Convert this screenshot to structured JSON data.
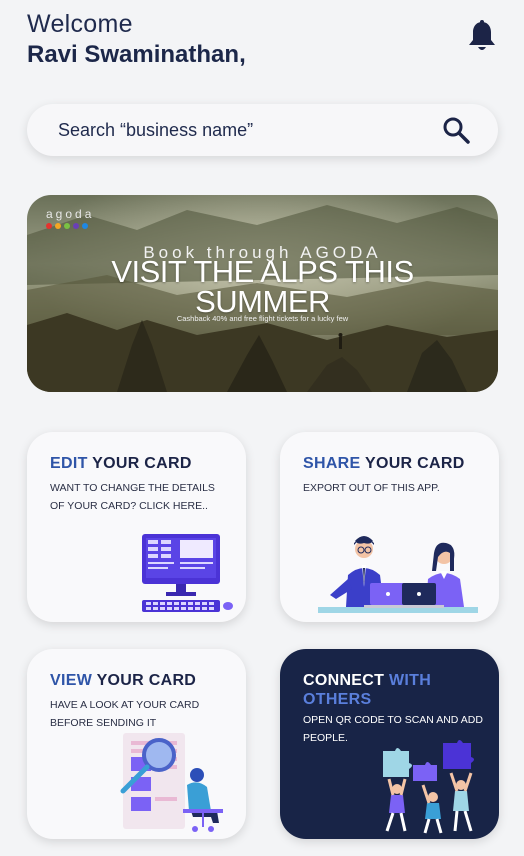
{
  "header": {
    "welcome": "Welcome",
    "user_name": "Ravi Swaminathan,"
  },
  "search": {
    "placeholder": "Search “business name”",
    "icon": "search-icon"
  },
  "banner": {
    "brand": "agoda",
    "brand_dot_colors": [
      "#e5322e",
      "#f5a623",
      "#7ac143",
      "#6a3fb5",
      "#1e88e5"
    ],
    "subtitle": "Book through AGODA",
    "title_line1": "VISIT THE ALPS THIS",
    "title_line2": "SUMMER",
    "tagline": "Cashback 40% and free flight tickets for a lucky few"
  },
  "cards": [
    {
      "accent": "EDIT",
      "title": "YOUR CARD",
      "description": "WANT TO CHANGE THE DETAILS OF YOUR CARD? CLICK HERE.."
    },
    {
      "accent": "SHARE",
      "title": "YOUR CARD",
      "description": "EXPORT OUT OF THIS APP."
    },
    {
      "accent": "VIEW",
      "title": "YOUR CARD",
      "description": "HAVE A LOOK AT YOUR CARD BEFORE SENDING IT"
    },
    {
      "title": "CONNECT",
      "accent": "WITH OTHERS",
      "description": "OPEN QR CODE TO SCAN AND ADD PEOPLE."
    }
  ],
  "colors": {
    "accent": "#2f55a8",
    "navy": "#1c2447",
    "dark_card": "#182447",
    "purple": "#5b3ee0"
  }
}
